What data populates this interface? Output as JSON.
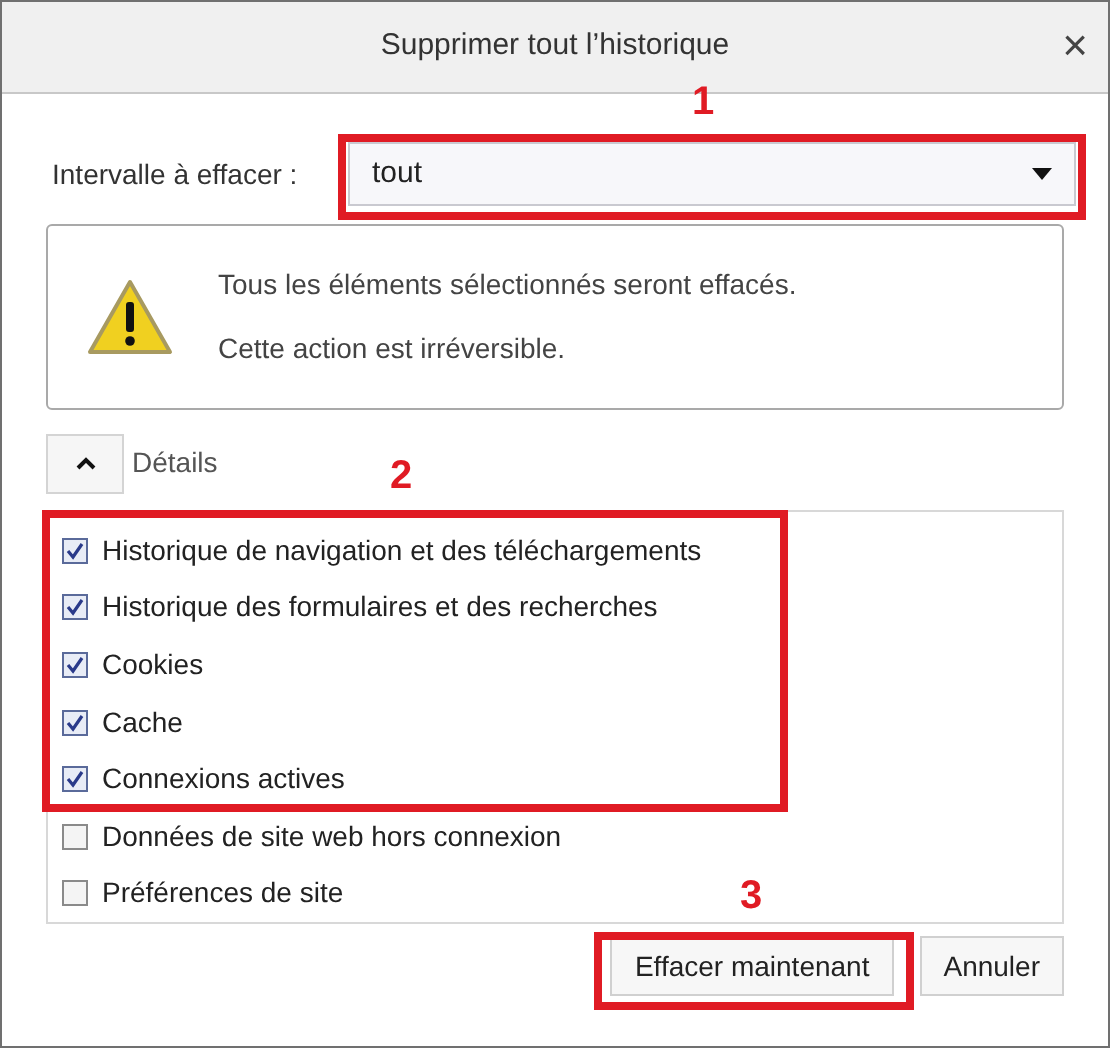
{
  "window": {
    "title": "Supprimer tout l’historique",
    "close": "×"
  },
  "range": {
    "label": "Intervalle à effacer :",
    "value": "tout"
  },
  "warning": {
    "lines": [
      "Tous les éléments sélectionnés seront effacés.",
      "Cette action est irréversible."
    ]
  },
  "details": {
    "label": "Détails",
    "expanded": true
  },
  "items": [
    {
      "label": "Historique de navigation et des téléchargements",
      "checked": true
    },
    {
      "label": "Historique des formulaires et des recherches",
      "checked": true
    },
    {
      "label": "Cookies",
      "checked": true
    },
    {
      "label": "Cache",
      "checked": true
    },
    {
      "label": "Connexions actives",
      "checked": true
    },
    {
      "label": "Données de site web hors connexion",
      "checked": false
    },
    {
      "label": "Préférences de site",
      "checked": false
    }
  ],
  "buttons": [
    "Effacer maintenant",
    "Annuler"
  ],
  "annotations": [
    {
      "label": "1"
    },
    {
      "label": "2"
    },
    {
      "label": "3"
    }
  ]
}
